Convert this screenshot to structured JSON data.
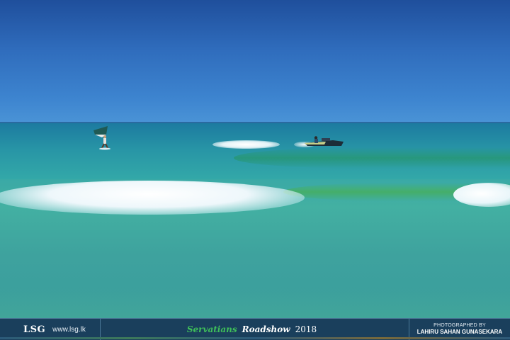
{
  "footer": {
    "logo_text": "LSG",
    "website": "www.lsg.lk",
    "event_part1": "Servatians",
    "event_part2": "Roadshow",
    "event_year": "2018",
    "photo_credit_label": "PHOTOGRAPHED BY",
    "photographer": "LAHIRU SAHAN GUNASEKARA"
  },
  "colors": {
    "sky": "#2f6cbc",
    "sea": "#2896a6",
    "footer_bg": "#1a3f5c",
    "event_accent": "#3fbf5a"
  }
}
